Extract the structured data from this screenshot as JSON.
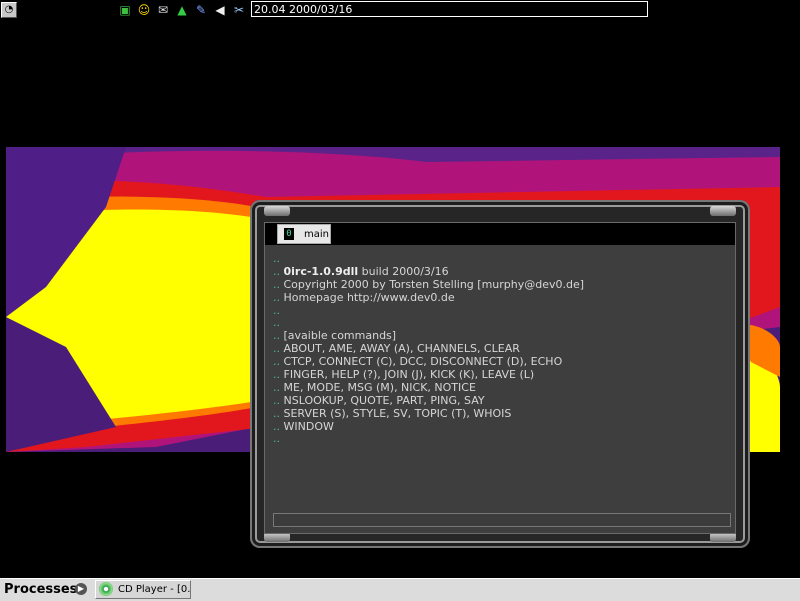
{
  "topbar": {
    "clock_text": "20.04 2000/03/16",
    "tray_icons": [
      "network-icon",
      "smiley-icon",
      "mail-icon",
      "tree-icon",
      "edit-icon",
      "volume-icon",
      "plugin-icon"
    ]
  },
  "irc": {
    "tab": {
      "number": "0",
      "label": "main"
    },
    "output_lines": [
      {
        "dots": "..",
        "text": ""
      },
      {
        "dots": "..",
        "bold": "0irc-1.0.9dll",
        "text": " build 2000/3/16"
      },
      {
        "dots": "..",
        "text": "Copyright 2000 by Torsten Stelling [murphy@dev0.de]"
      },
      {
        "dots": "..",
        "text": "Homepage http://www.dev0.de"
      },
      {
        "dots": "..",
        "text": ""
      },
      {
        "dots": "..",
        "text": ""
      },
      {
        "dots": "..",
        "text": "[avaible commands]"
      },
      {
        "dots": "..",
        "text": "ABOUT, AME, AWAY (A), CHANNELS, CLEAR"
      },
      {
        "dots": "..",
        "text": "CTCP, CONNECT (C), DCC, DISCONNECT (D), ECHO"
      },
      {
        "dots": "..",
        "text": "FINGER, HELP (?), JOIN (J), KICK (K), LEAVE (L)"
      },
      {
        "dots": "..",
        "text": "ME, MODE, MSG (M), NICK, NOTICE"
      },
      {
        "dots": "..",
        "text": "NSLOOKUP, QUOTE, PART, PING, SAY"
      },
      {
        "dots": "..",
        "text": "SERVER (S), STYLE, SV, TOPIC (T), WHOIS"
      },
      {
        "dots": "..",
        "text": "WINDOW"
      },
      {
        "dots": "..",
        "text": ""
      }
    ]
  },
  "taskbar": {
    "processes_label": "Processes",
    "task_label": "CD Player - [0..."
  },
  "colors": {
    "wallpaper_purple": "#5a2389",
    "wallpaper_magenta": "#c0187a",
    "wallpaper_red": "#ee1a1a",
    "wallpaper_orange": "#ff8a00",
    "wallpaper_yellow": "#ffff00",
    "irc_accent": "#46c08a"
  }
}
